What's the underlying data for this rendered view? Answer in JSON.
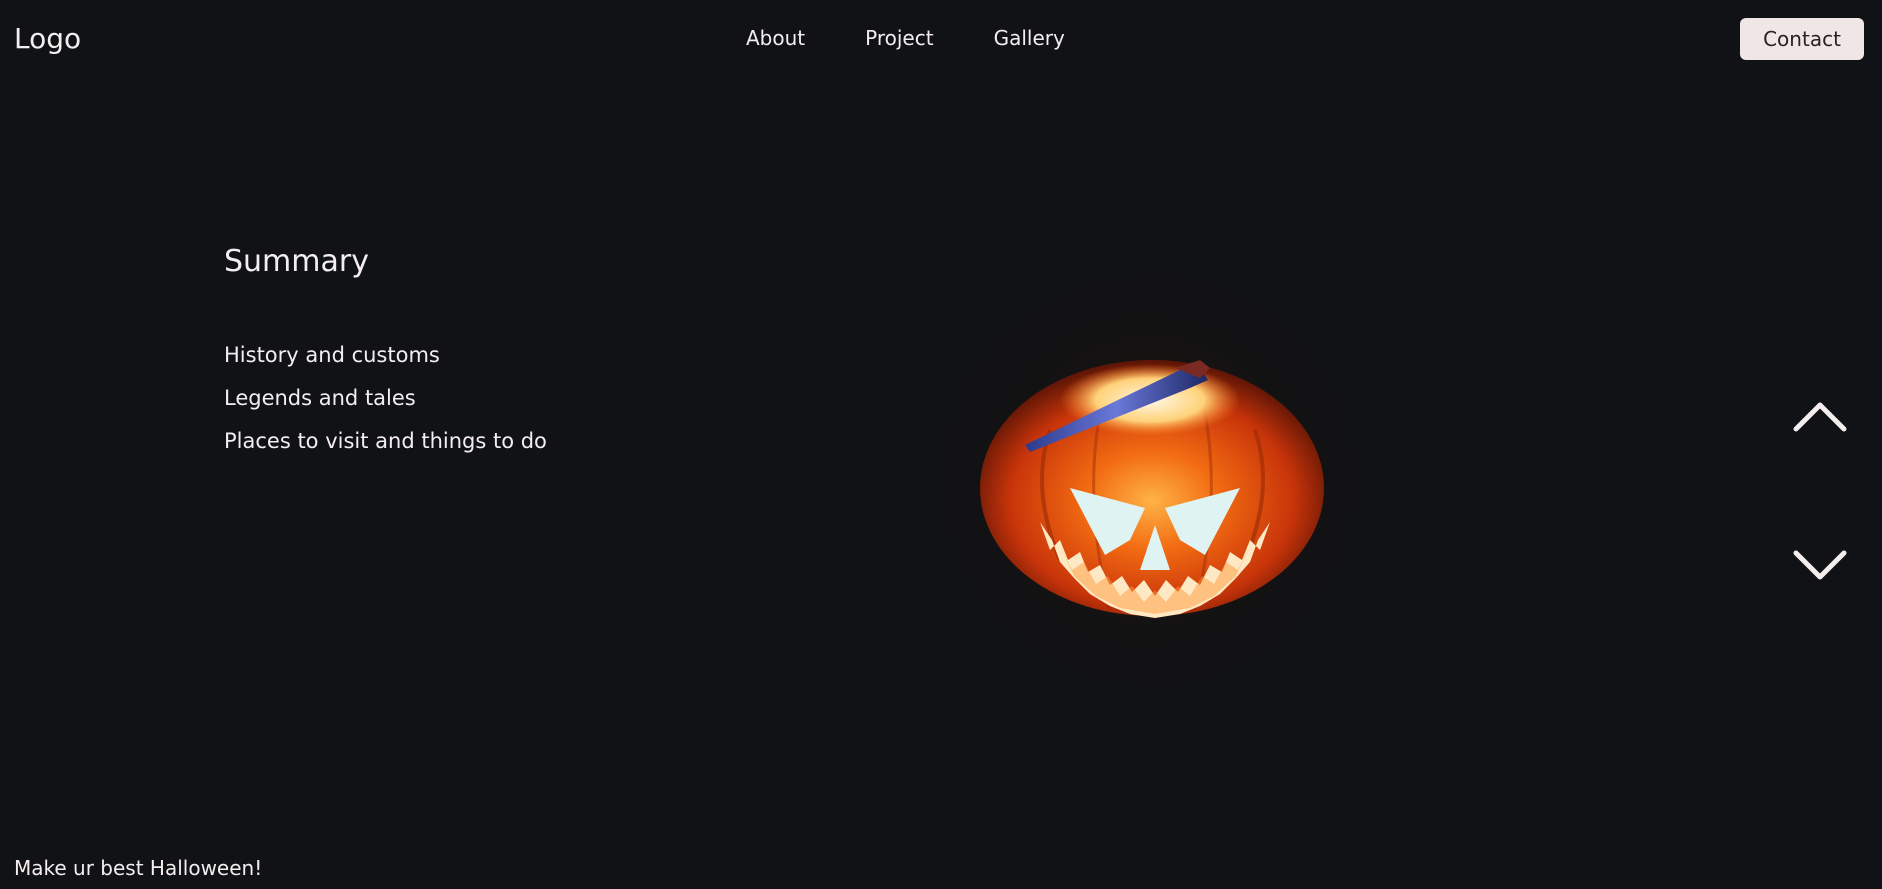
{
  "header": {
    "logo": "Logo",
    "nav": [
      "About",
      "Project",
      "Gallery"
    ],
    "contact_label": "Contact"
  },
  "summary": {
    "title": "Summary",
    "items": [
      "History and customs",
      "Legends and tales",
      "Places to visit and things to do"
    ]
  },
  "hero_image": {
    "icon": "jack-o-lantern-pumpkin-image"
  },
  "controls": {
    "up_icon": "chevron-up-icon",
    "down_icon": "chevron-down-icon"
  },
  "footer": {
    "tagline": "Make ur best Halloween!"
  },
  "colors": {
    "background": "#111216",
    "text": "#f4eeee",
    "button_bg": "#f1e6e6",
    "button_text": "#2a2222",
    "pumpkin_orange": "#e2500e"
  }
}
